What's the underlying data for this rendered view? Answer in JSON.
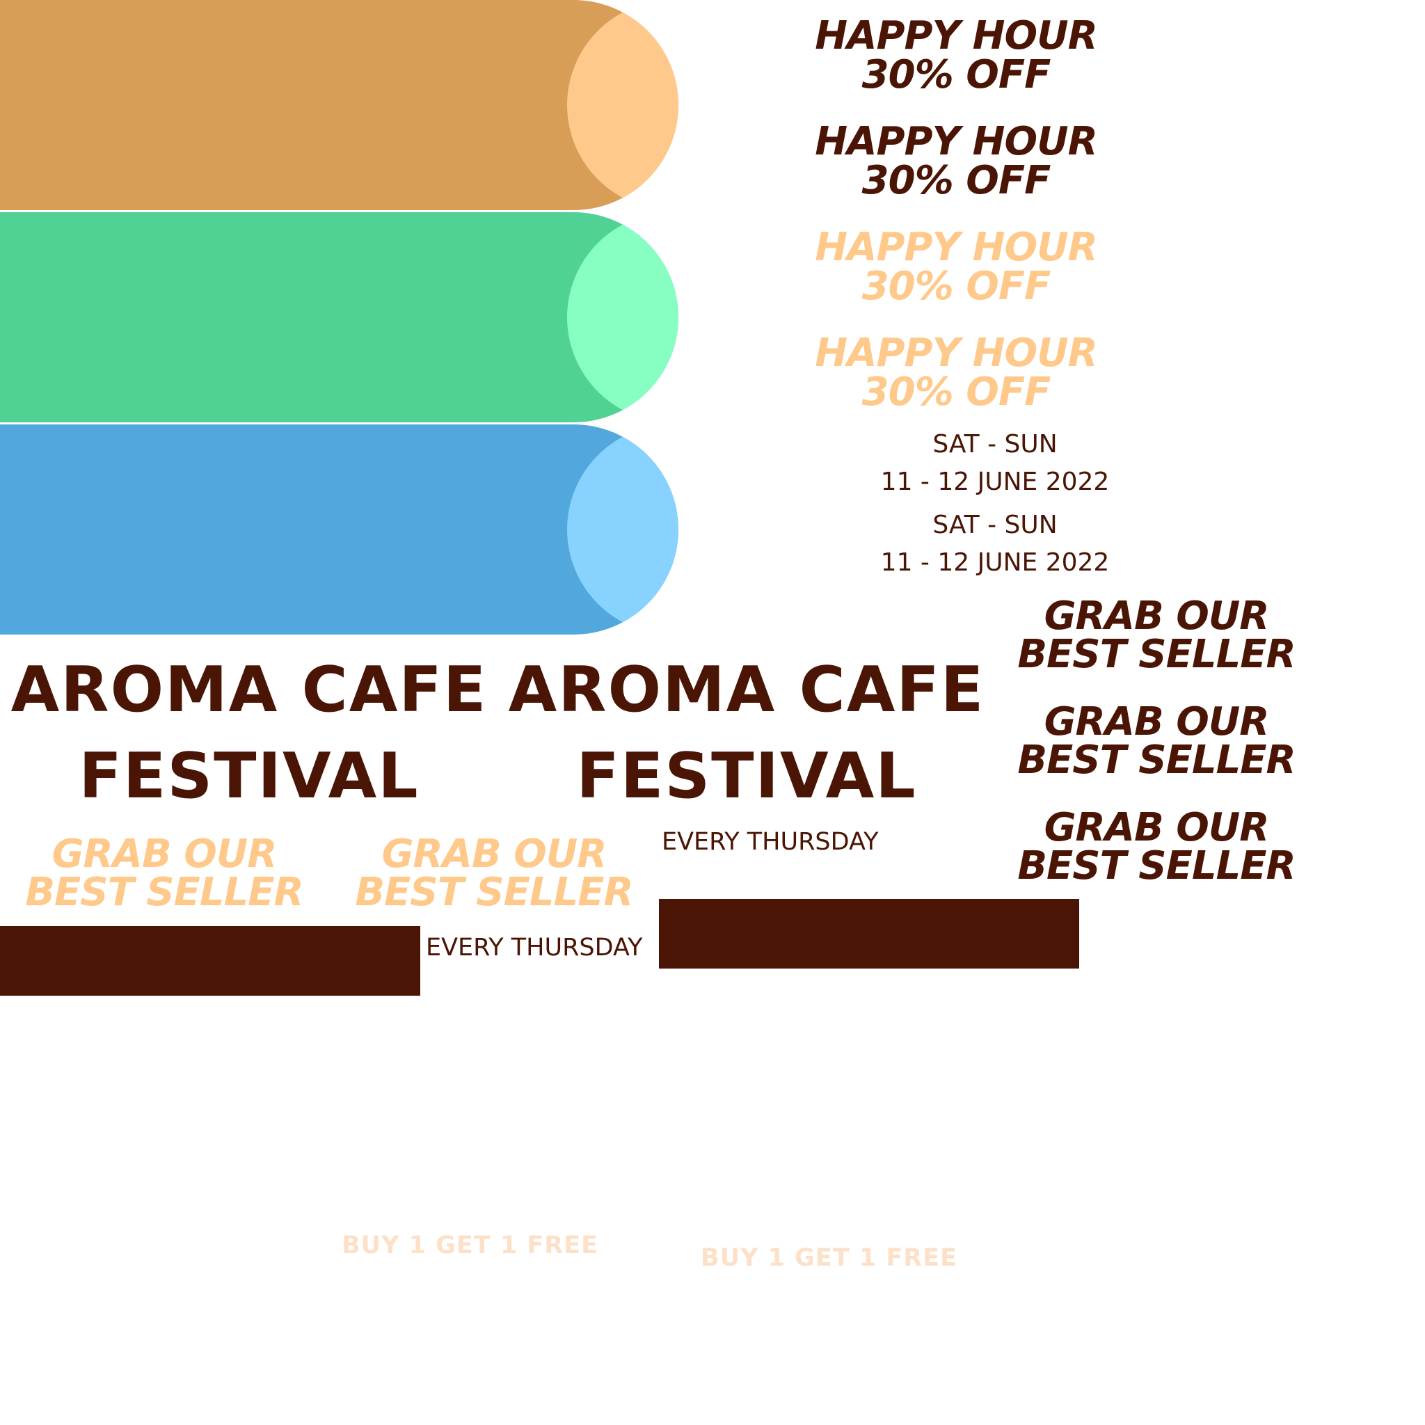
{
  "colors": {
    "dark_brown": "#4a1505",
    "peach": "#fec98a",
    "pale_peach": "#fde0c8",
    "orange_bar": "#d89d57",
    "orange_circle": "#fec98a",
    "green_bar": "#4fd294",
    "green_circle": "#87fec2",
    "blue_bar": "#52a7dc",
    "blue_circle": "#87d2fe"
  },
  "promo_dark": [
    {
      "line1": "HAPPY HOUR",
      "line2": "30% OFF"
    },
    {
      "line1": "HAPPY HOUR",
      "line2": "30% OFF"
    }
  ],
  "promo_light": [
    {
      "line1": "HAPPY HOUR",
      "line2": "30% OFF"
    },
    {
      "line1": "HAPPY HOUR",
      "line2": "30% OFF"
    }
  ],
  "dates": [
    {
      "days": "SAT - SUN",
      "range": "11 - 12 JUNE 2022"
    },
    {
      "days": "SAT - SUN",
      "range": "11 - 12 JUNE 2022"
    }
  ],
  "festival": [
    {
      "line1": "AROMA CAFE",
      "line2": "FESTIVAL"
    },
    {
      "line1": "AROMA CAFE",
      "line2": "FESTIVAL"
    }
  ],
  "grab_dark": [
    {
      "line1": "GRAB OUR",
      "line2": "BEST SELLER"
    },
    {
      "line1": "GRAB OUR",
      "line2": "BEST SELLER"
    },
    {
      "line1": "GRAB OUR",
      "line2": "BEST SELLER"
    }
  ],
  "grab_light": [
    {
      "line1": "GRAB OUR",
      "line2": "BEST SELLER"
    },
    {
      "line1": "GRAB OUR",
      "line2": "BEST SELLER"
    }
  ],
  "thursday": [
    "EVERY THURSDAY",
    "EVERY THURSDAY"
  ],
  "buy": [
    "BUY 1 GET 1 FREE",
    "BUY 1 GET 1 FREE"
  ]
}
